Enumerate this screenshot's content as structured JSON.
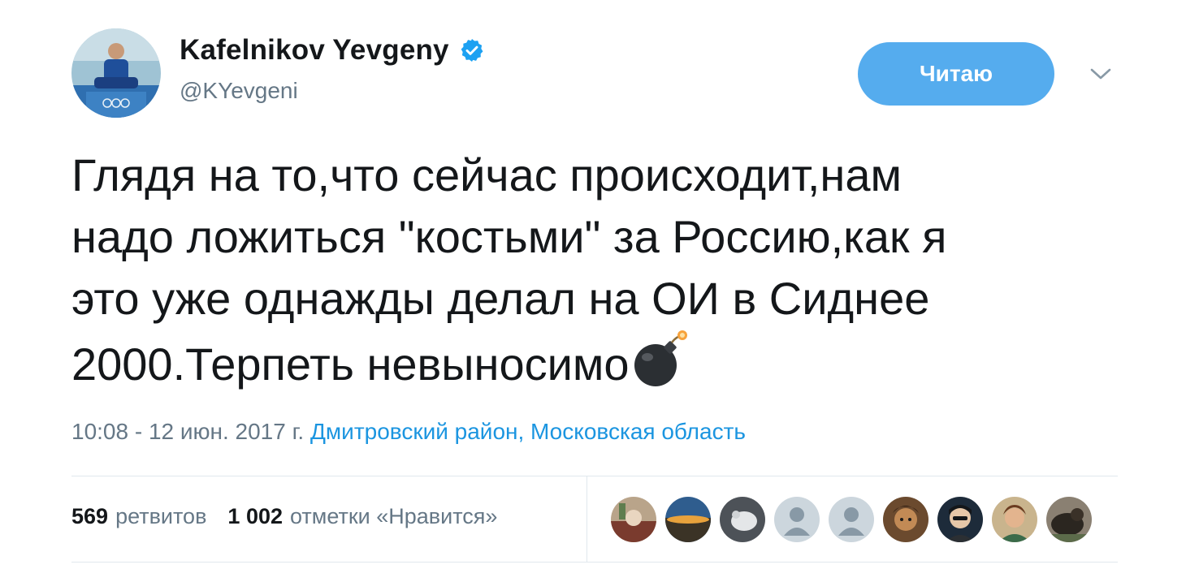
{
  "author": {
    "display_name": "Kafelnikov Yevgeny",
    "handle": "@KYevgeni",
    "verified": true
  },
  "follow_button": {
    "label": "Читаю"
  },
  "tweet": {
    "lines": [
      "Глядя на то,что сейчас происходит,нам",
      "надо ложиться \"костьми\" за Россию,как я",
      "это уже однажды делал на ОИ в Сиднее",
      "2000.Терпеть невыносимо"
    ],
    "emoji": "bomb-icon"
  },
  "meta": {
    "timestamp": "10:08 - 12 июн. 2017 г.",
    "location": "Дмитровский район, Московская область"
  },
  "stats": {
    "retweets_count": "569",
    "retweets_label": "ретвитов",
    "likes_count": "1 002",
    "likes_label": "отметки «Нравится»"
  },
  "likers": [
    "liker-avatar-1",
    "liker-avatar-2",
    "liker-avatar-3",
    "liker-avatar-4",
    "liker-avatar-5",
    "liker-avatar-6",
    "liker-avatar-7",
    "liker-avatar-8",
    "liker-avatar-9"
  ],
  "colors": {
    "accent": "#55acee",
    "link": "#1b95e0",
    "verified": "#1da1f2",
    "secondary_text": "#657786"
  }
}
